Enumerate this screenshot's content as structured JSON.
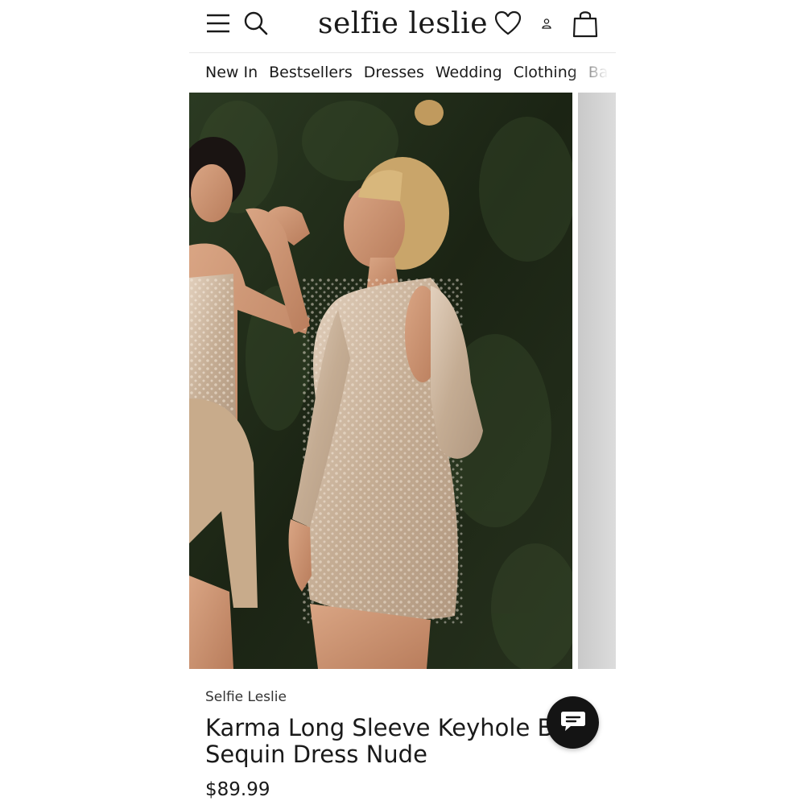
{
  "header": {
    "logo": "selfie leslie",
    "icons": [
      "menu-icon",
      "search-icon",
      "heart-icon",
      "user-icon",
      "bag-icon"
    ]
  },
  "nav": {
    "items": [
      "New In",
      "Bestsellers",
      "Dresses",
      "Wedding",
      "Clothing",
      "Ba"
    ]
  },
  "product": {
    "brand": "Selfie Leslie",
    "title_line1": "Karma Long Sleeve Keyhole Ba",
    "title_line2": "Sequin Dress Nude",
    "price": "$89.99"
  },
  "chat": {
    "icon": "chat-icon"
  },
  "colors": {
    "text": "#1a1a1a",
    "background": "#ffffff",
    "chat_button": "#141414",
    "hedge": "#1f2a17",
    "dress": "#c9b39a"
  }
}
